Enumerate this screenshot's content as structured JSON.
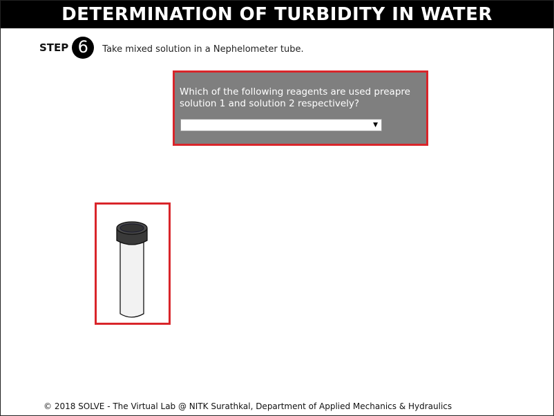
{
  "header": {
    "title": "DETERMINATION OF TURBIDITY IN WATER"
  },
  "step": {
    "label": "STEP",
    "number": "6",
    "instruction": "Take mixed solution in a Nephelometer tube."
  },
  "question": {
    "text": "Which of the following reagents are used preapre solution 1 and solution 2 respectively?",
    "selected_value": "",
    "dropdown_icon": "▼"
  },
  "apparatus": {
    "icon": "nephelometer-tube-icon"
  },
  "footer": {
    "text": "© 2018 SOLVE - The Virtual Lab @ NITK Surathkal, Department of Applied Mechanics & Hydraulics"
  },
  "colors": {
    "title_bar": "#000000",
    "highlight_border": "#d9252a",
    "question_panel": "#7f7f7f",
    "tube_cap": "#3a3a3a",
    "tube_body": "#f2f2f2"
  }
}
